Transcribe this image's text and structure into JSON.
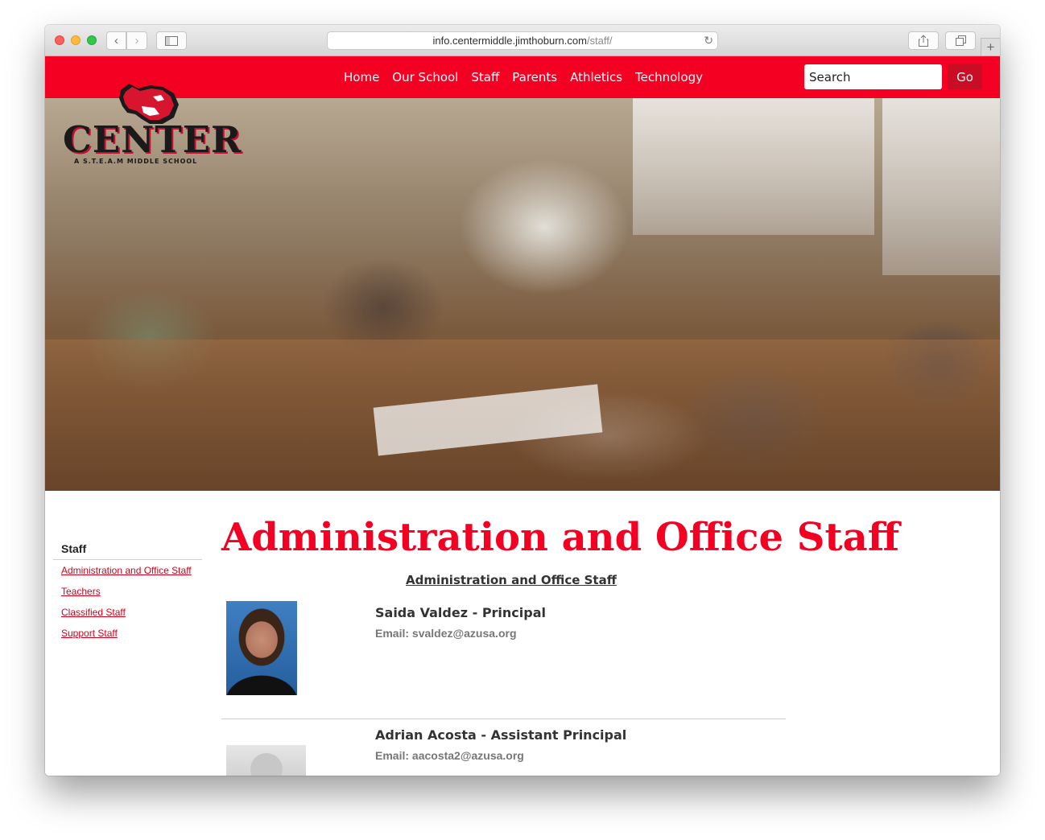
{
  "browser": {
    "url_host": "info.centermiddle.jimthoburn.com",
    "url_path": "/staff/"
  },
  "nav": {
    "links": [
      "Home",
      "Our School",
      "Staff",
      "Parents",
      "Athletics",
      "Technology"
    ],
    "search_placeholder": "Search",
    "go_label": "Go"
  },
  "logo": {
    "title": "CENTER",
    "subtitle": "A S.T.E.A.M MIDDLE SCHOOL"
  },
  "sidebar": {
    "heading": "Staff",
    "links": [
      "Administration and Office Staff",
      "Teachers",
      "Classified Staff",
      "Support Staff"
    ]
  },
  "main": {
    "page_title": "Administration and Office Staff",
    "section_heading": "Administration and Office Staff",
    "staff": [
      {
        "name": "Saida Valdez - Principal",
        "email": "Email: svaldez@azusa.org"
      },
      {
        "name": "Adrian Acosta - Assistant Principal",
        "email": "Email: aacosta2@azusa.org"
      }
    ]
  },
  "colors": {
    "brand_red": "#f40023",
    "go_button": "#c80d24",
    "link_red": "#d0021b"
  }
}
